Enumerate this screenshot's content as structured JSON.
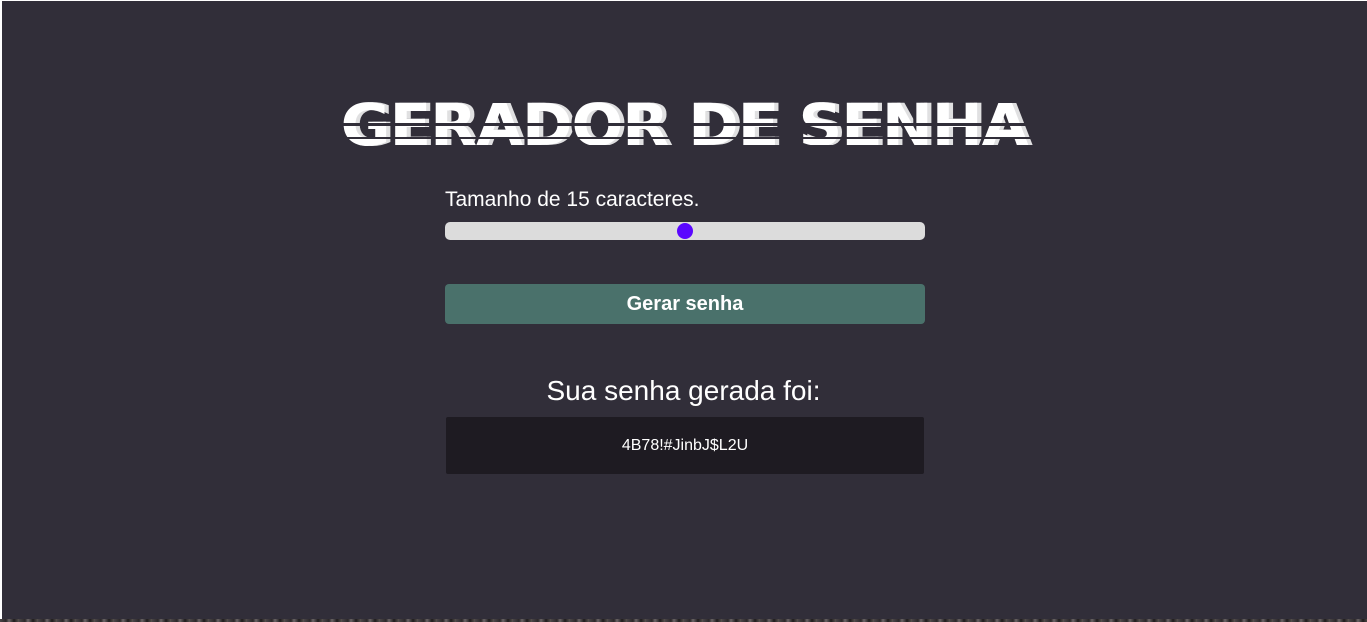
{
  "app": {
    "title": "GERADOR DE SENHA"
  },
  "slider": {
    "label": "Tamanho de 15 caracteres.",
    "fill_fraction": 0.5
  },
  "button": {
    "label": "Gerar senha"
  },
  "result": {
    "title": "Sua senha gerada foi:",
    "password": "4B78!#JinbJ$L2U"
  },
  "colors": {
    "background": "#312e39",
    "button": "#4a716b",
    "slider_thumb": "#5a07ff",
    "result_box": "#1e1b22"
  }
}
